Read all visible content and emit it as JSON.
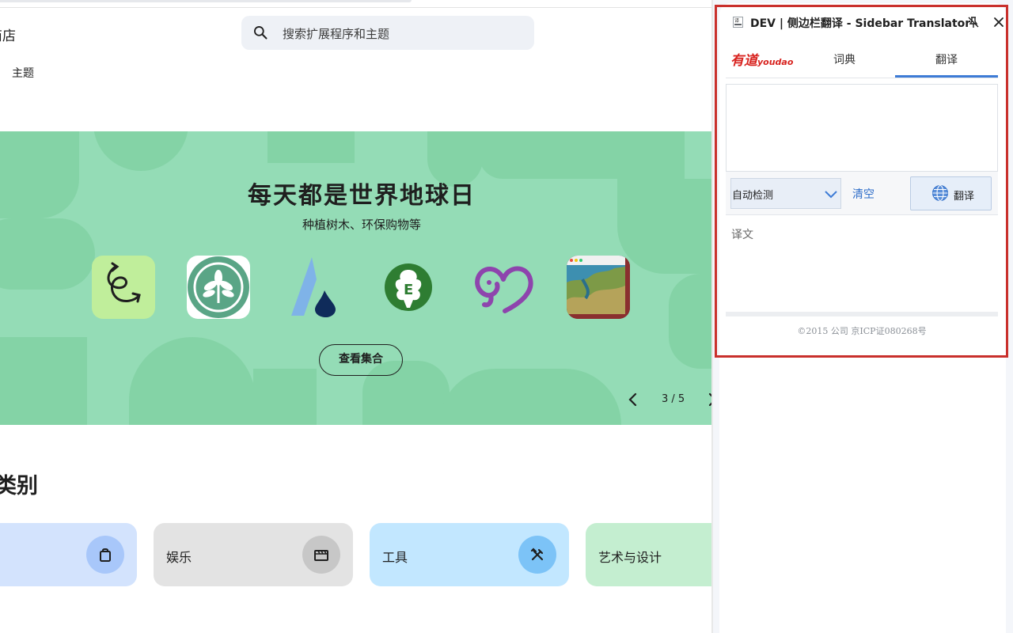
{
  "store": {
    "name": "商店",
    "search_placeholder": "搜索扩展程序和主题",
    "nav_theme": "主题",
    "banner": {
      "title": "每天都是世界地球日",
      "subtitle": "种植树木、环保购物等",
      "button": "查看集合",
      "pager": "3 / 5",
      "icons": [
        "ecosia-spiral-icon",
        "tree-leaves-icon",
        "water-drop-icon",
        "e-tree-icon",
        "elephant-icon",
        "map-window-icon"
      ]
    },
    "categories_title": "类别",
    "categories": [
      {
        "label": "",
        "icon": "shopping-bag-icon",
        "bg": "#d3e3fd",
        "icon_bg": "#a8c7fa"
      },
      {
        "label": "娱乐",
        "icon": "clapperboard-icon",
        "bg": "#e3e3e3",
        "icon_bg": "#c7c7c7"
      },
      {
        "label": "工具",
        "icon": "tools-icon",
        "bg": "#c2e7ff",
        "icon_bg": "#7cc3f7"
      },
      {
        "label": "艺术与设计",
        "icon": "",
        "bg": "#c4eed0",
        "icon_bg": "#a5dcb4"
      }
    ]
  },
  "sidepanel": {
    "title": "DEV | 侧边栏翻译 - Sidebar Translator",
    "logo_cn": "有道",
    "logo_en": "youdao",
    "tabs": [
      "词典",
      "翻译"
    ],
    "active_tab": "翻译",
    "source_text": "",
    "lang_select": "自动检测",
    "clear": "清空",
    "translate_button": "翻译",
    "result_label": "译文",
    "copyright": "©2015 公司 京ICP证080268号"
  },
  "colors": {
    "banner": "#94dcb6",
    "accent": "#3d7bd6",
    "highlight_border": "#c9302c",
    "youdao_red": "#d8231f"
  }
}
